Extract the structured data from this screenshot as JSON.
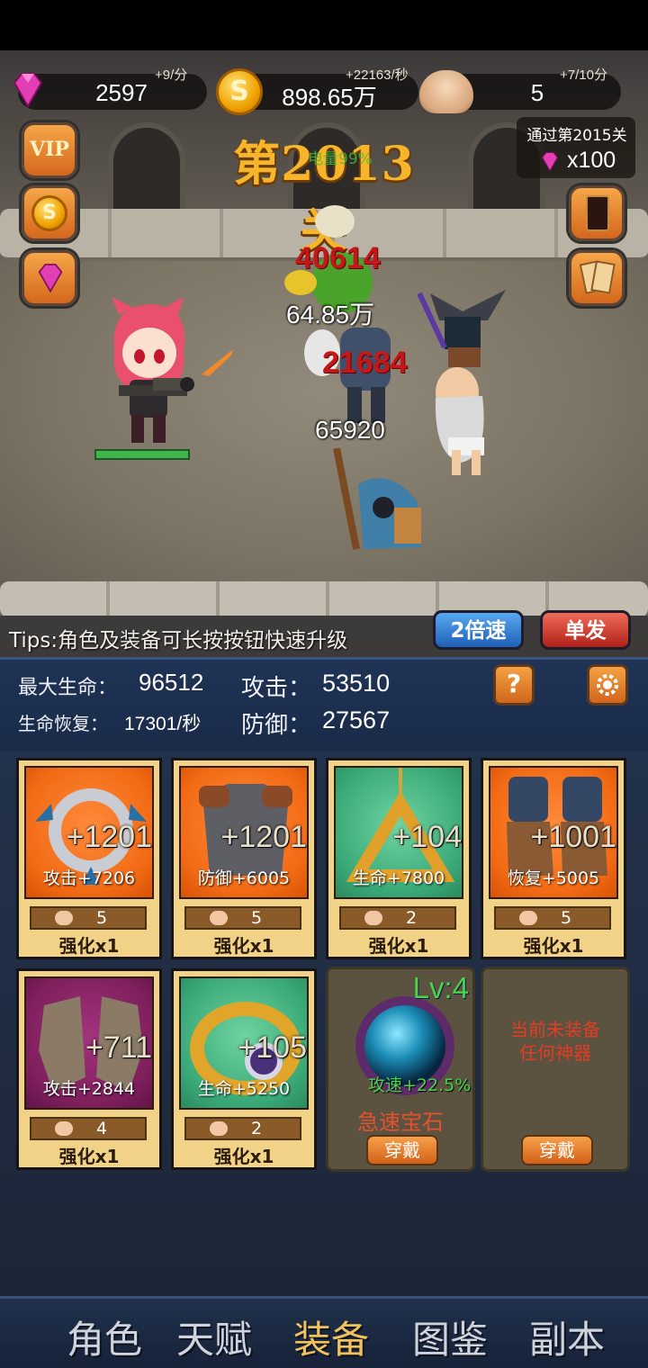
{
  "resources": {
    "gems": {
      "icon": "pink-gem-icon",
      "value": "2597",
      "rate": "+9/分"
    },
    "gold": {
      "icon": "gold-coin-icon",
      "value": "898.65万",
      "rate": "+22163/秒"
    },
    "skulls": {
      "icon": "skull-icon",
      "value": "5",
      "rate": "+7/10分"
    }
  },
  "side_buttons": {
    "vip_label": "VIP"
  },
  "level": {
    "title": "第2013关",
    "sub": "电量99%"
  },
  "pass_reward": {
    "label": "通过第2015关",
    "amount": "x100"
  },
  "battle": {
    "damage_numbers": [
      "40614",
      "64.85万",
      "21684",
      "65920"
    ],
    "hero_hp_fraction": 1.0
  },
  "tips": "Tips:角色及装备可长按按钮快速升级",
  "controls": {
    "speed": "2倍速",
    "fire": "单发"
  },
  "stats": {
    "max_hp_label": "最大生命：",
    "max_hp": "96512",
    "regen_label": "生命恢复：",
    "regen": "17301/秒",
    "attack_label": "攻击：",
    "attack": "53510",
    "defense_label": "防御：",
    "defense": "27567",
    "help": "?"
  },
  "equipment": [
    {
      "name": "weapon",
      "level": "+1201",
      "bonus": "攻击+7206",
      "cost": "5",
      "upgrade": "强化x1",
      "bg": "orange"
    },
    {
      "name": "armor",
      "level": "+1201",
      "bonus": "防御+6005",
      "cost": "5",
      "upgrade": "强化x1",
      "bg": "orange"
    },
    {
      "name": "amulet",
      "level": "+104",
      "bonus": "生命+7800",
      "cost": "2",
      "upgrade": "强化x1",
      "bg": "green"
    },
    {
      "name": "boots",
      "level": "+1001",
      "bonus": "恢复+5005",
      "cost": "5",
      "upgrade": "强化x1",
      "bg": "orange"
    },
    {
      "name": "gloves",
      "level": "+711",
      "bonus": "攻击+2844",
      "cost": "4",
      "upgrade": "强化x1",
      "bg": "purple"
    },
    {
      "name": "ring",
      "level": "+105",
      "bonus": "生命+5250",
      "cost": "2",
      "upgrade": "强化x1",
      "bg": "green"
    }
  ],
  "gem_slot": {
    "level": "Lv:4",
    "bonus": "攻速+22.5%",
    "name": "急速宝石",
    "button": "穿戴"
  },
  "artifact_slot": {
    "line1": "当前未装备",
    "line2": "任何神器",
    "button": "穿戴"
  },
  "nav": {
    "items": [
      "角色",
      "天赋",
      "装备",
      "图鉴",
      "副本"
    ],
    "active": "装备"
  }
}
